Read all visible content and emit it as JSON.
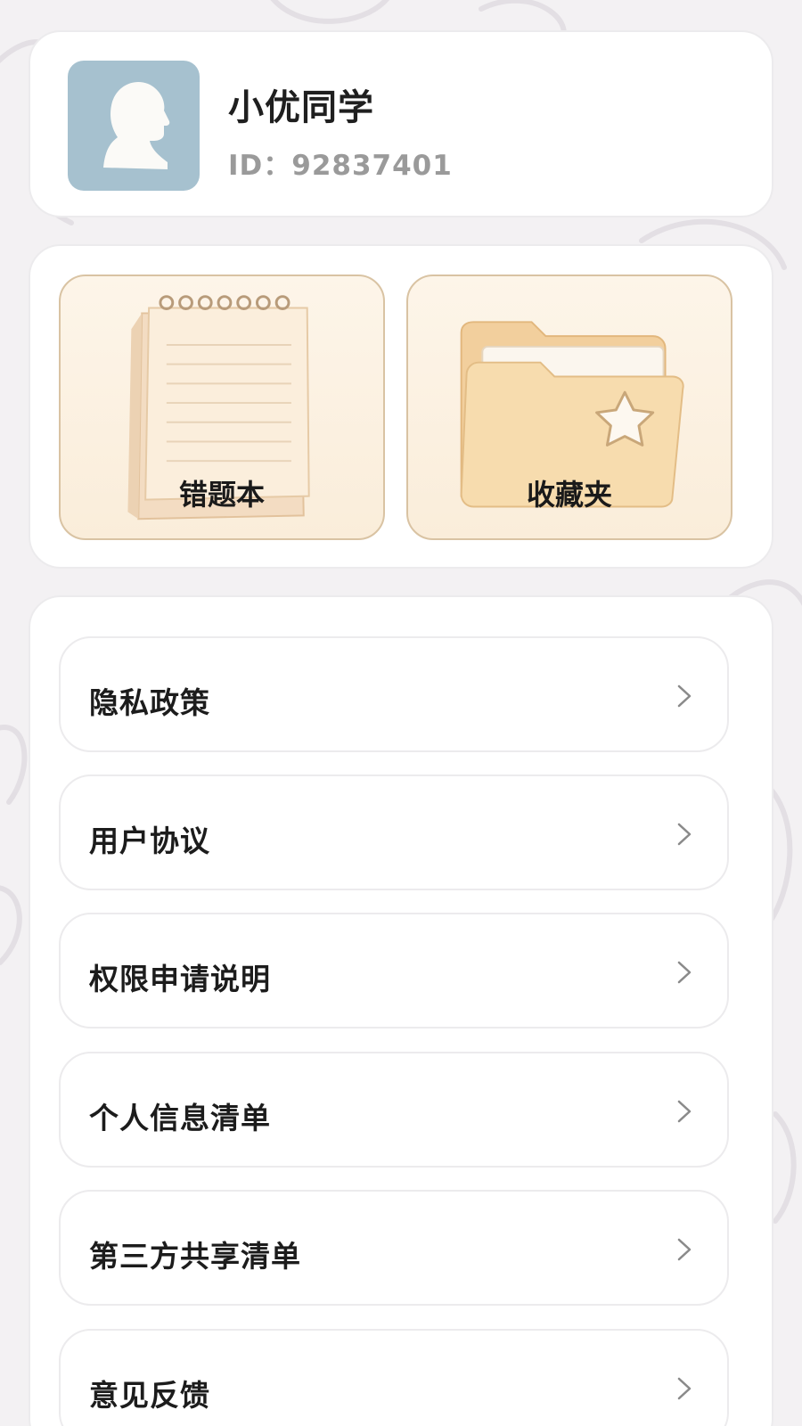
{
  "profile": {
    "name": "小优同学",
    "id_text": "ID：92837401",
    "avatar_icon": "user-silhouette-icon"
  },
  "tiles": [
    {
      "label": "错题本",
      "icon": "notebook-icon"
    },
    {
      "label": "收藏夹",
      "icon": "star-folder-icon"
    }
  ],
  "menu": {
    "items": [
      {
        "label": "隐私政策"
      },
      {
        "label": "用户协议"
      },
      {
        "label": "权限申请说明"
      },
      {
        "label": "个人信息清单"
      },
      {
        "label": "第三方共享清单"
      },
      {
        "label": "意见反馈"
      }
    ],
    "chevron_icon": "chevron-right-icon"
  },
  "colors": {
    "background": "#f3f1f3",
    "card": "#ffffff",
    "avatar_bg": "#a6c1cf",
    "tile_bg": "#faedda",
    "tile_border": "#d9c3a3",
    "text_primary": "#1f1f1f",
    "text_secondary": "#9a9a9a"
  }
}
